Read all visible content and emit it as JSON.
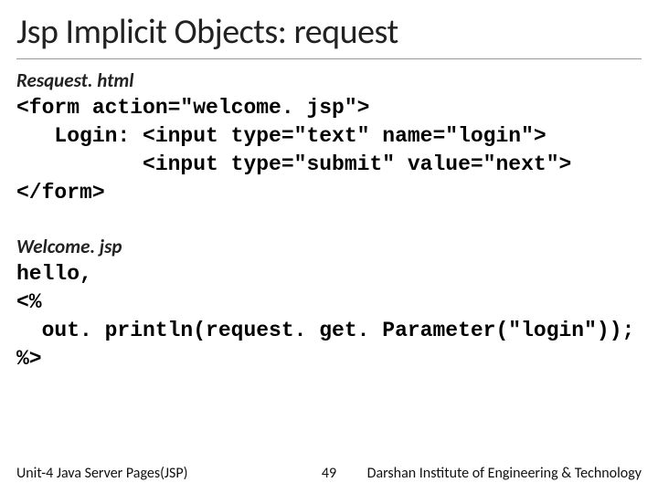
{
  "title": "Jsp Implicit Objects: request",
  "file1": {
    "name": "Resquest. html",
    "code": "<form action=\"welcome. jsp\">\n   Login: <input type=\"text\" name=\"login\">\n          <input type=\"submit\" value=\"next\">\n</form>"
  },
  "file2": {
    "name": "Welcome. jsp",
    "code": "hello,\n<%\n  out. println(request. get. Parameter(\"login\"));\n%>"
  },
  "footer": {
    "left": "Unit-4 Java Server Pages(JSP)",
    "page": "49",
    "right": "Darshan Institute of Engineering & Technology"
  }
}
